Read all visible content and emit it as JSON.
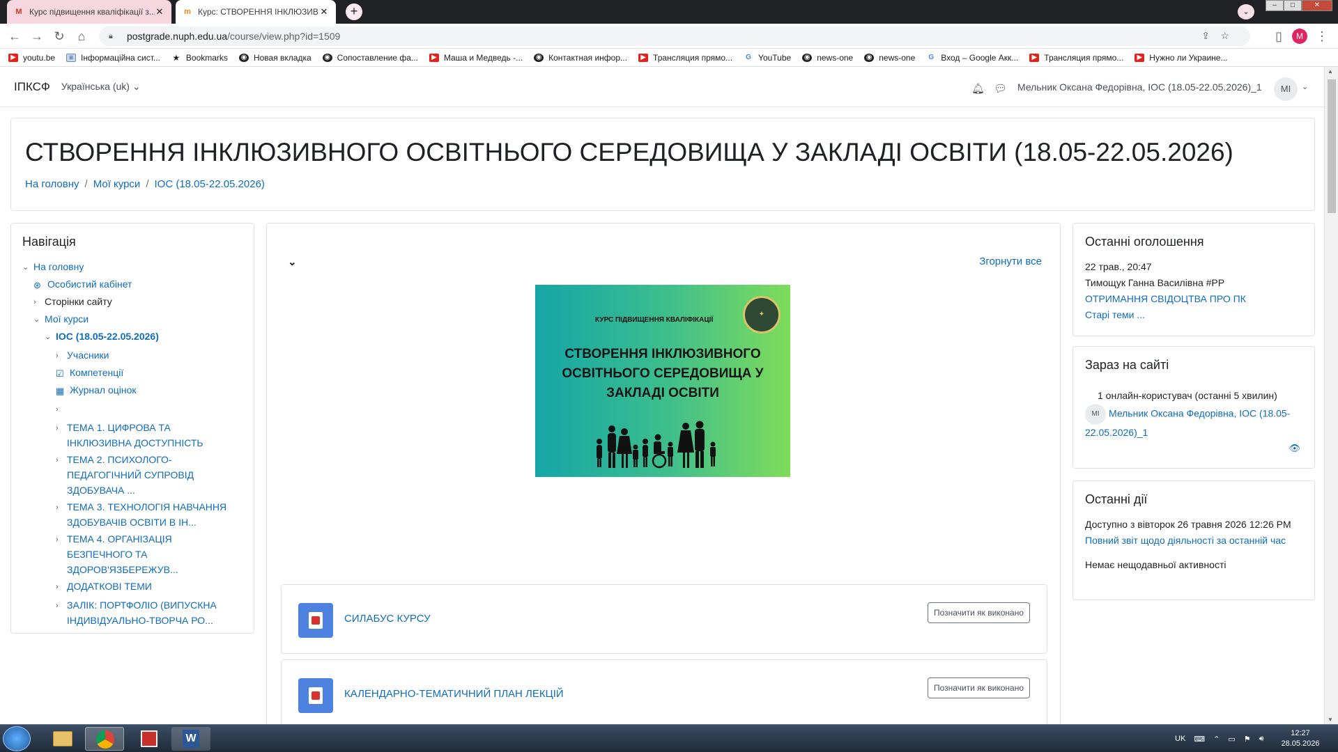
{
  "browser": {
    "tabs": [
      {
        "title": "Курс підвищення кваліфікації з...",
        "favicon": "M",
        "active": false
      },
      {
        "title": "Курс: СТВОРЕННЯ ІНКЛЮЗИВН",
        "favicon": "m",
        "active": true
      }
    ],
    "new_tab": "+",
    "url": {
      "host": "postgrade.nuph.edu.ua",
      "path": "/course/view.php?id=1509"
    },
    "profile_initial": "M",
    "bookmarks": [
      {
        "label": "youtu.be",
        "icon": "youtube-icon"
      },
      {
        "label": "Інформаційна сист...",
        "icon": "document-icon"
      },
      {
        "label": "Bookmarks",
        "icon": "star-icon"
      },
      {
        "label": "Новая вкладка",
        "icon": "globe-icon"
      },
      {
        "label": "Сопоставление фа...",
        "icon": "globe-icon"
      },
      {
        "label": "Маша и Медведь -...",
        "icon": "youtube-icon"
      },
      {
        "label": "Контактная инфор...",
        "icon": "globe-icon"
      },
      {
        "label": "Трансляция прямо...",
        "icon": "youtube-icon"
      },
      {
        "label": "YouTube",
        "icon": "google-icon"
      },
      {
        "label": "news-one",
        "icon": "globe-icon"
      },
      {
        "label": "news-one",
        "icon": "globe-icon"
      },
      {
        "label": "Вход – Google Акк...",
        "icon": "google-icon"
      },
      {
        "label": "Трансляция прямо...",
        "icon": "youtube-icon"
      },
      {
        "label": "Нужно ли Украине...",
        "icon": "youtube-icon"
      }
    ]
  },
  "site": {
    "brand": "ІПКСФ",
    "language": "Українська (uk)",
    "user_name": "Мельник Оксана Федорівна, ІОС (18.05-22.05.2026)_1",
    "user_initials": "MI"
  },
  "course": {
    "title": "СТВОРЕННЯ ІНКЛЮЗИВНОГО ОСВІТНЬОГО СЕРЕДОВИЩА У ЗАКЛАДІ ОСВІТИ (18.05-22.05.2026)",
    "breadcrumb": [
      "На головну",
      "Мої курси",
      "ІОС (18.05-22.05.2026)"
    ]
  },
  "navigation": {
    "title": "Навігація",
    "items": [
      {
        "label": "На головну",
        "chev": "⌄",
        "icon": "",
        "link": true,
        "bold": false,
        "indent": 0
      },
      {
        "label": "Особистий кабінет",
        "chev": "",
        "icon": "dashboard-icon",
        "link": true,
        "bold": false,
        "indent": 1
      },
      {
        "label": "Сторінки сайту",
        "chev": "›",
        "icon": "",
        "link": false,
        "bold": false,
        "indent": 1
      },
      {
        "label": "Мої курси",
        "chev": "⌄",
        "icon": "",
        "link": true,
        "bold": false,
        "indent": 1
      },
      {
        "label": "ІОС (18.05-22.05.2026)",
        "chev": "⌄",
        "icon": "",
        "link": true,
        "bold": true,
        "indent": 2
      },
      {
        "label": "Учасники",
        "chev": "›",
        "icon": "",
        "link": true,
        "bold": false,
        "indent": 3
      },
      {
        "label": "Компетенції",
        "chev": "",
        "icon": "checkbox-icon",
        "link": true,
        "bold": false,
        "indent": 3
      },
      {
        "label": "Журнал оцінок",
        "chev": "",
        "icon": "table-icon",
        "link": true,
        "bold": false,
        "indent": 3
      },
      {
        "label": "",
        "chev": "›",
        "icon": "",
        "link": true,
        "bold": false,
        "indent": 3
      },
      {
        "label": "ТЕМА 1. ЦИФРОВА ТА ІНКЛЮЗИВНА ДОСТУПНІСТЬ",
        "chev": "›",
        "icon": "",
        "link": true,
        "bold": false,
        "indent": 3
      },
      {
        "label": "ТЕМА 2. ПСИХОЛОГО-ПЕДАГОГІЧНИЙ СУПРОВІД ЗДОБУВАЧА ...",
        "chev": "›",
        "icon": "",
        "link": true,
        "bold": false,
        "indent": 3
      },
      {
        "label": "ТЕМА 3. ТЕХНОЛОГІЯ НАВЧАННЯ ЗДОБУВАЧІВ ОСВІТИ В ІН...",
        "chev": "›",
        "icon": "",
        "link": true,
        "bold": false,
        "indent": 3
      },
      {
        "label": "ТЕМА 4. ОРГАНІЗАЦІЯ БЕЗПЕЧНОГО ТА ЗДОРОВ'ЯЗБЕРЕЖУВ...",
        "chev": "›",
        "icon": "",
        "link": true,
        "bold": false,
        "indent": 3
      },
      {
        "label": "ДОДАТКОВІ ТЕМИ",
        "chev": "›",
        "icon": "",
        "link": true,
        "bold": false,
        "indent": 3
      },
      {
        "label": "ЗАЛІК: ПОРТФОЛІО (ВИПУСКНА ІНДИВІДУАЛЬНО-ТВОРЧА РО...",
        "chev": "›",
        "icon": "",
        "link": true,
        "bold": false,
        "indent": 3
      }
    ]
  },
  "main": {
    "collapse_all": "Згорнути все",
    "banner": {
      "subtitle": "КУРС ПІДВИЩЕННЯ КВАЛІФІКАЦІЇ",
      "title": "СТВОРЕННЯ ІНКЛЮЗИВНОГО ОСВІТНЬОГО СЕРЕДОВИЩА У ЗАКЛАДІ ОСВІТИ"
    },
    "activities": [
      {
        "name": "СИЛАБУС КУРСУ",
        "button": "Позначити як виконано"
      },
      {
        "name": "КАЛЕНДАРНО-ТЕМАТИЧНИЙ ПЛАН ЛЕКЦІЙ",
        "button": "Позначити як виконано"
      }
    ]
  },
  "blocks": {
    "news": {
      "title": "Останні оголошення",
      "date": "22 трав., 20:47",
      "author": "Тимощук Ганна Василівна #PP",
      "link": "ОТРИМАННЯ СВІДОЦТВА ПРО ПК",
      "older": "Старі теми ..."
    },
    "online": {
      "title": "Зараз на сайті",
      "count": "1 онлайн-користувач (останні 5 хвилин)",
      "user": "Мельник Оксана Федорівна, ІОС (18.05-22.05.2026)_1",
      "initials": "MI"
    },
    "activity": {
      "title": "Останні дії",
      "since": "Доступно з вівторок 26 травня 2026 12:26 PM",
      "report": "Повний звіт щодо діяльності за останній час",
      "none": "Немає нещодавньої активності"
    }
  },
  "taskbar": {
    "lang": "UK",
    "time": "12:27",
    "date": "28.05.2026"
  }
}
